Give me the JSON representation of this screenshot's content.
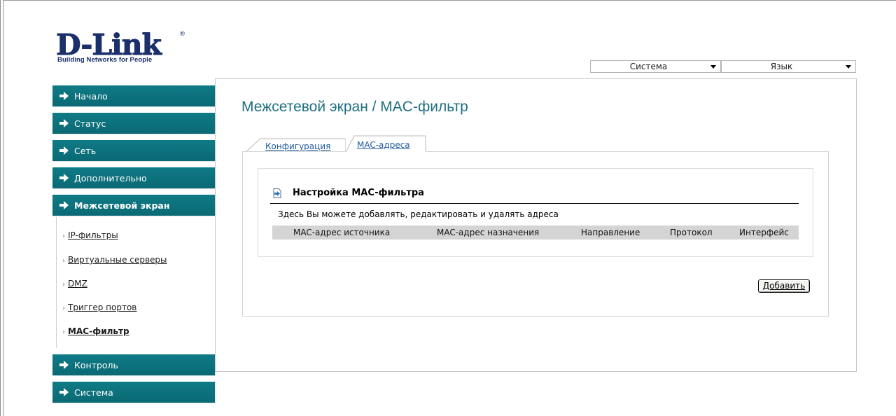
{
  "brand": {
    "logo_text": "D-Link",
    "registered": "®",
    "tagline": "Building Networks for People"
  },
  "top_selects": {
    "system": "Система",
    "language": "Язык"
  },
  "sidebar": {
    "items": [
      {
        "label": "Начало"
      },
      {
        "label": "Статус"
      },
      {
        "label": "Сеть"
      },
      {
        "label": "Дополнительно"
      },
      {
        "label": "Межсетевой экран"
      },
      {
        "label": "Контроль"
      },
      {
        "label": "Система"
      }
    ],
    "subitems": [
      {
        "label": "IP-фильтры"
      },
      {
        "label": "Виртуальные серверы"
      },
      {
        "label": "DMZ"
      },
      {
        "label": "Триггер портов"
      },
      {
        "label": "MAC-фильтр"
      }
    ]
  },
  "main": {
    "title": "Межсетевой экран / MAC-фильтр",
    "tabs": [
      {
        "label": "Конфигурация"
      },
      {
        "label": "MAC-адреса"
      }
    ],
    "section": {
      "title": "Настройка MAC-фильтра",
      "description": "Здесь Вы можете добавлять, редактировать и удалять адреса"
    },
    "table": {
      "columns": [
        "MAC-адрес источника",
        "MAC-адрес назначения",
        "Направление",
        "Протокол",
        "Интерфейс"
      ],
      "rows": []
    },
    "add_button": "Добавить"
  },
  "colors": {
    "menu_bg": "#0c717c",
    "title": "#1f6f80",
    "brand": "#1b2f6b"
  }
}
